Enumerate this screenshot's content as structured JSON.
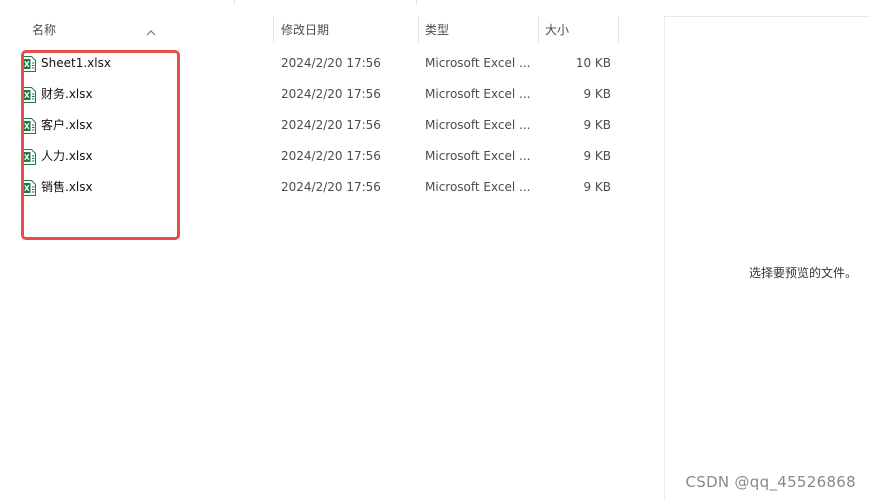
{
  "columns": {
    "name": "名称",
    "date": "修改日期",
    "type": "类型",
    "size": "大小"
  },
  "sort_icon": "sort-ascending-icon",
  "file_icon": "excel-file-icon",
  "files": [
    {
      "name": "Sheet1.xlsx",
      "date": "2024/2/20 17:56",
      "type": "Microsoft Excel ...",
      "size": "10 KB"
    },
    {
      "name": "财务.xlsx",
      "date": "2024/2/20 17:56",
      "type": "Microsoft Excel ...",
      "size": "9 KB"
    },
    {
      "name": "客户.xlsx",
      "date": "2024/2/20 17:56",
      "type": "Microsoft Excel ...",
      "size": "9 KB"
    },
    {
      "name": "人力.xlsx",
      "date": "2024/2/20 17:56",
      "type": "Microsoft Excel ...",
      "size": "9 KB"
    },
    {
      "name": "销售.xlsx",
      "date": "2024/2/20 17:56",
      "type": "Microsoft Excel ...",
      "size": "9 KB"
    }
  ],
  "preview": {
    "message": "选择要预览的文件。"
  },
  "watermark": "CSDN @qq_45526868",
  "colors": {
    "highlight": "#e94a4a",
    "excel_green": "#1f7a44"
  }
}
